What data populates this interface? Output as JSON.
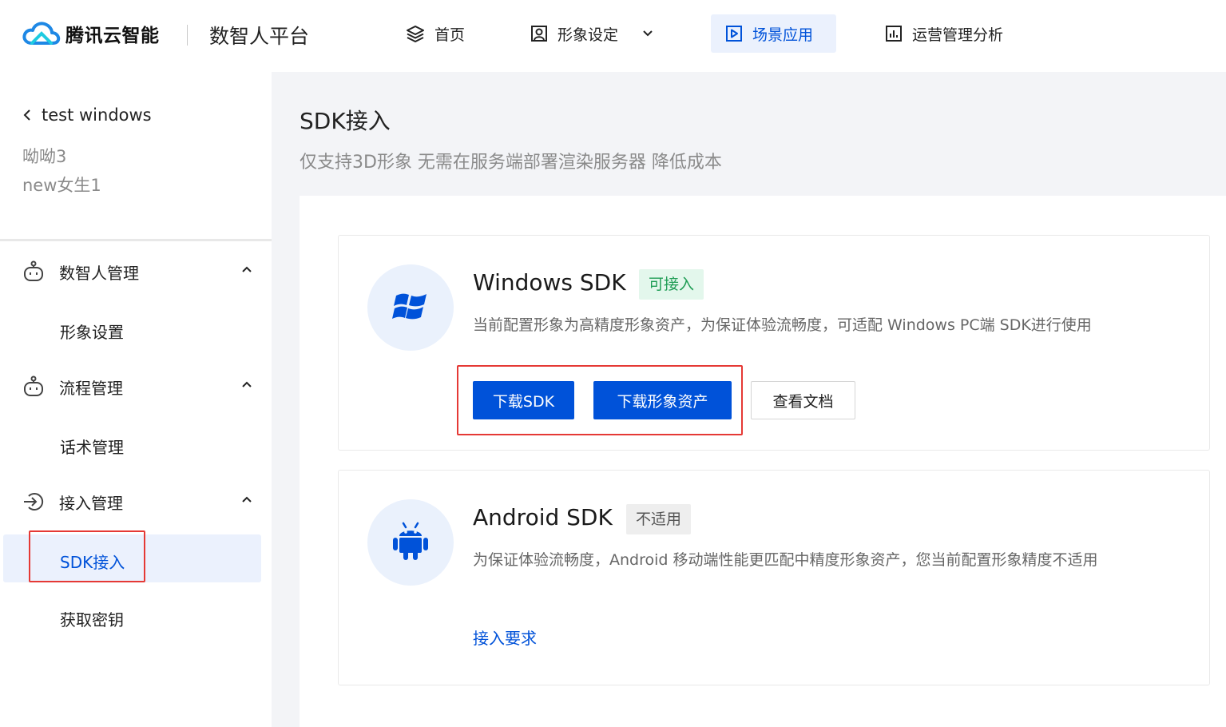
{
  "brand": {
    "name": "腾讯云智能",
    "platform": "数智人平台",
    "logo_color": "#1e88e5"
  },
  "nav": [
    {
      "label": "首页",
      "icon": "layers-icon"
    },
    {
      "label": "形象设定",
      "icon": "portrait-icon"
    },
    {
      "label": "场景应用",
      "icon": "play-icon",
      "active": true
    },
    {
      "label": "运营管理分析",
      "icon": "bar-chart-icon"
    }
  ],
  "sidebar": {
    "back_label": "test windows",
    "sub1": "呦呦3",
    "sub2": "new女生1",
    "groups": [
      {
        "label": "数智人管理",
        "icon": "robot-icon",
        "items": [
          "形象设置"
        ]
      },
      {
        "label": "流程管理",
        "icon": "robot-icon",
        "items": [
          "话术管理"
        ]
      },
      {
        "label": "接入管理",
        "icon": "login-icon",
        "items": [
          "SDK接入",
          "获取密钥"
        ]
      }
    ],
    "active_item": "SDK接入"
  },
  "main": {
    "title": "SDK接入",
    "desc": "仅支持3D形象 无需在服务端部署渲染服务器 降低成本",
    "cards": [
      {
        "title": "Windows SDK",
        "icon": "windows-icon",
        "tag": "可接入",
        "desc": "当前配置形象为高精度形象资产，为保证体验流畅度，可适配 Windows PC端 SDK进行使用",
        "buttons": {
          "download_sdk": "下载SDK",
          "download_asset": "下载形象资产",
          "view_docs": "查看文档"
        }
      },
      {
        "title": "Android SDK",
        "icon": "android-icon",
        "tag": "不适用",
        "desc": "为保证体验流畅度，Android 移动端性能更匹配中精度形象资产，您当前配置形象精度不适用",
        "link": "接入要求"
      }
    ]
  },
  "colors": {
    "primary": "#0052d9",
    "success": "#1f9d55",
    "highlight": "#e53935"
  }
}
